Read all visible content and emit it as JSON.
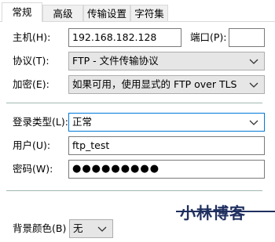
{
  "tabs": [
    {
      "label": "常规"
    },
    {
      "label": "高级"
    },
    {
      "label": "传输设置"
    },
    {
      "label": "字符集"
    }
  ],
  "host": {
    "label": "主机(H):",
    "value": "192.168.182.128"
  },
  "port": {
    "label": "端口(P):",
    "value": ""
  },
  "protocol": {
    "label": "协议(T):",
    "value": "FTP - 文件传输协议"
  },
  "encryption": {
    "label": "加密(E):",
    "value": "如果可用，使用显式的 FTP over TLS"
  },
  "logon_type": {
    "label": "登录类型(L):",
    "value": "正常"
  },
  "user": {
    "label": "用户(U):",
    "value": "ftp_test"
  },
  "password": {
    "label": "密码(W):",
    "value": "●●●●●●●●●"
  },
  "background_color": {
    "label": "背景颜色(B)",
    "value": "无"
  },
  "watermark": {
    "text": "小林博客"
  },
  "colors": {
    "focus_border": "#0078d7",
    "watermark": "#1f2f5f"
  }
}
